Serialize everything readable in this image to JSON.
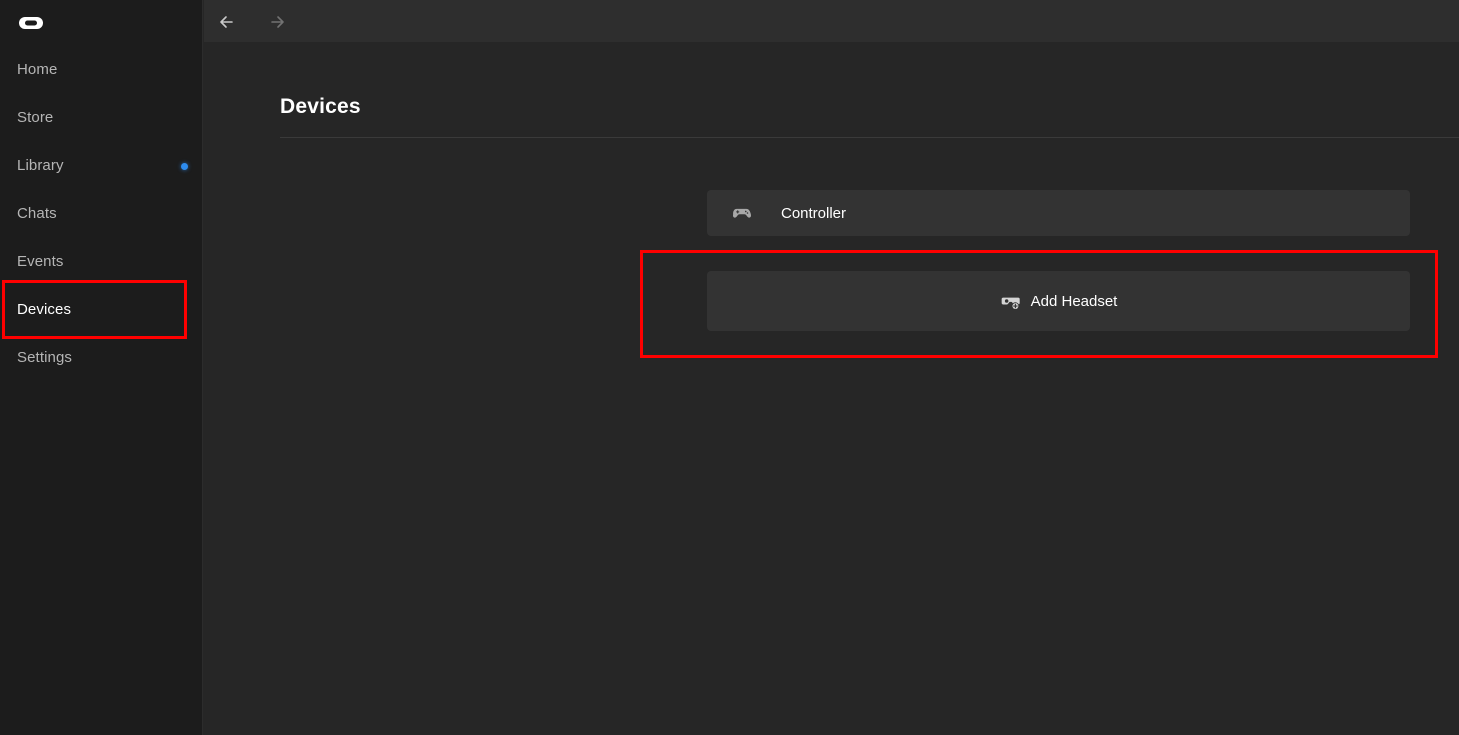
{
  "app": {
    "name": "Oculus",
    "logo_icon": "oculus-logo-icon",
    "background_color": "#262626",
    "sidebar_color": "#1c1c1c",
    "card_color": "#333333",
    "accent_color": "#2d8cf0",
    "annotation_color": "#fe0000"
  },
  "sidebar": {
    "items": [
      {
        "label": "Home",
        "active": false,
        "badge": false
      },
      {
        "label": "Store",
        "active": false,
        "badge": false
      },
      {
        "label": "Library",
        "active": false,
        "badge": true
      },
      {
        "label": "Chats",
        "active": false,
        "badge": false
      },
      {
        "label": "Events",
        "active": false,
        "badge": false
      },
      {
        "label": "Devices",
        "active": true,
        "badge": false
      },
      {
        "label": "Settings",
        "active": false,
        "badge": false
      }
    ]
  },
  "topbar": {
    "back_icon": "arrow-left-icon",
    "forward_icon": "arrow-right-icon",
    "back_enabled": true,
    "forward_enabled": false
  },
  "main": {
    "title": "Devices",
    "cards": [
      {
        "label": "Controller",
        "icon": "gamepad-icon",
        "align": "left"
      },
      {
        "label": "Add Headset",
        "icon": "headset-plus-icon",
        "align": "center"
      }
    ]
  },
  "annotations": [
    {
      "name": "sidebar-devices-highlight",
      "target": "Devices"
    },
    {
      "name": "add-headset-highlight",
      "target": "Add Headset"
    }
  ]
}
